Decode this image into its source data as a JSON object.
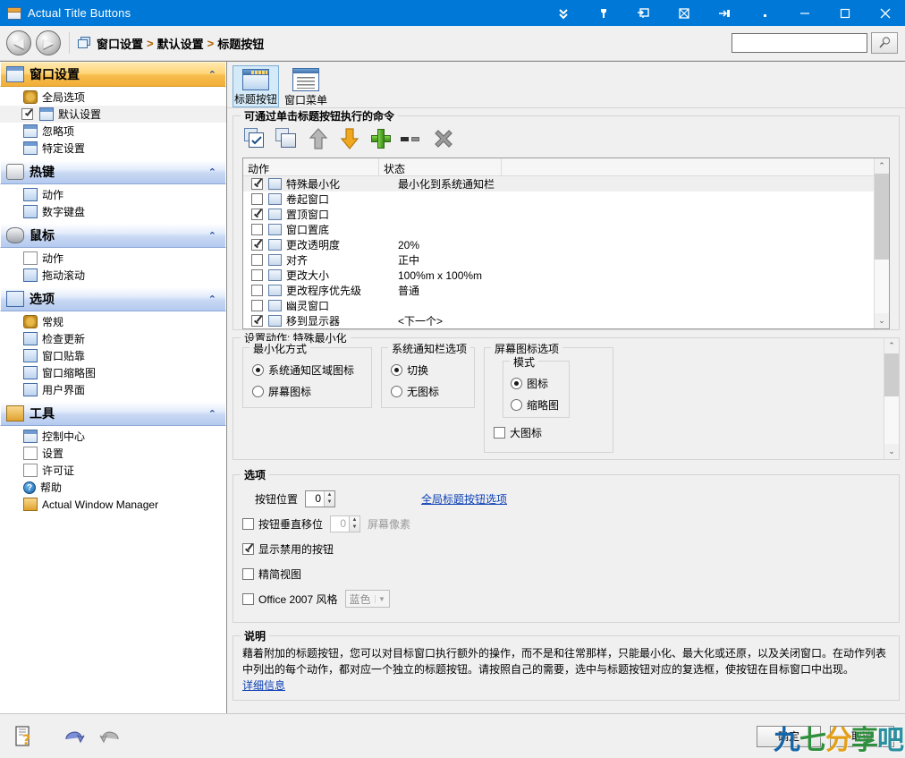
{
  "window": {
    "title": "Actual Title Buttons",
    "icon": "window-app-icon",
    "titlebar_buttons": [
      {
        "name": "collapse-all-icon",
        "glyph": "⯆"
      },
      {
        "name": "pin-tool-icon",
        "glyph": "⚲"
      },
      {
        "name": "export-icon",
        "glyph": "⊞"
      },
      {
        "name": "transparency-icon",
        "glyph": "▨"
      },
      {
        "name": "roll-up-icon",
        "glyph": "⇥"
      },
      {
        "name": "dot-icon",
        "glyph": "·"
      },
      {
        "name": "minimize-icon",
        "glyph": "—"
      },
      {
        "name": "maximize-icon",
        "glyph": "▢"
      },
      {
        "name": "close-icon",
        "glyph": "✕"
      }
    ]
  },
  "nav": {
    "back_glyph": "◀",
    "forward_glyph": "▶",
    "breadcrumb": [
      "窗口设置",
      "默认设置",
      "标题按钮"
    ],
    "separator": ">",
    "search_value": "",
    "search_placeholder": "",
    "search_button_icon": "search-icon"
  },
  "sidebar": {
    "groups": [
      {
        "title": "窗口设置",
        "style": "orange",
        "icon": "window-settings-icon",
        "collapse_glyph": "⌃",
        "items": [
          {
            "label": "全局选项",
            "icon": "global-options-icon",
            "checkbox": false,
            "selected": false
          },
          {
            "label": "默认设置",
            "icon": "default-settings-icon",
            "checkbox": true,
            "checked": true,
            "selected": true
          },
          {
            "label": "忽略项",
            "icon": "ignore-icon",
            "checkbox": false,
            "selected": false
          },
          {
            "label": "特定设置",
            "icon": "specific-settings-icon",
            "checkbox": false,
            "selected": false
          }
        ]
      },
      {
        "title": "热键",
        "style": "blue",
        "icon": "keyboard-icon",
        "collapse_glyph": "⌃",
        "items": [
          {
            "label": "动作",
            "icon": "action-icon",
            "checkbox": false,
            "selected": false
          },
          {
            "label": "数字键盘",
            "icon": "numpad-icon",
            "checkbox": false,
            "selected": false
          }
        ]
      },
      {
        "title": "鼠标",
        "style": "blue",
        "icon": "mouse-icon",
        "collapse_glyph": "⌃",
        "items": [
          {
            "label": "动作",
            "icon": "action-icon",
            "checkbox": false,
            "selected": false
          },
          {
            "label": "拖动滚动",
            "icon": "drag-scroll-icon",
            "checkbox": false,
            "selected": false
          }
        ]
      },
      {
        "title": "选项",
        "style": "blue",
        "icon": "options-icon",
        "collapse_glyph": "⌃",
        "items": [
          {
            "label": "常规",
            "icon": "general-icon",
            "checkbox": false,
            "selected": false
          },
          {
            "label": "检查更新",
            "icon": "check-updates-icon",
            "checkbox": false,
            "selected": false
          },
          {
            "label": "窗口贴靠",
            "icon": "window-snap-icon",
            "checkbox": false,
            "selected": false
          },
          {
            "label": "窗口缩略图",
            "icon": "window-thumbnail-icon",
            "checkbox": false,
            "selected": false
          },
          {
            "label": "用户界面",
            "icon": "user-interface-icon",
            "checkbox": false,
            "selected": false
          }
        ]
      },
      {
        "title": "工具",
        "style": "blue",
        "icon": "tools-icon",
        "collapse_glyph": "⌃",
        "items": [
          {
            "label": "控制中心",
            "icon": "control-center-icon",
            "checkbox": false,
            "selected": false
          },
          {
            "label": "设置",
            "icon": "settings-icon",
            "checkbox": false,
            "selected": false
          },
          {
            "label": "许可证",
            "icon": "license-key-icon",
            "checkbox": false,
            "selected": false
          },
          {
            "label": "帮助",
            "icon": "help-icon",
            "checkbox": false,
            "selected": false
          },
          {
            "label": "Actual Window Manager",
            "icon": "actual-window-manager-icon",
            "checkbox": false,
            "selected": false
          }
        ]
      }
    ]
  },
  "tabs": [
    {
      "label": "标题按钮",
      "icon": "title-buttons-icon",
      "active": true
    },
    {
      "label": "窗口菜单",
      "icon": "window-menu-icon",
      "active": false
    }
  ],
  "command_group": {
    "legend": "可通过单击标题按钮执行的命令",
    "toolbar": [
      {
        "name": "check-all-button",
        "icon": "check-copy-icon"
      },
      {
        "name": "copy-button",
        "icon": "copy-icon"
      },
      {
        "name": "move-up-button",
        "icon": "up-arrow-icon"
      },
      {
        "name": "move-down-button",
        "icon": "down-arrow-icon"
      },
      {
        "name": "add-button",
        "icon": "plus-icon"
      },
      {
        "name": "remove-button",
        "icon": "minus-icon"
      },
      {
        "name": "delete-button",
        "icon": "x-close-icon"
      }
    ]
  },
  "action_list": {
    "columns": [
      "动作",
      "状态"
    ],
    "rows": [
      {
        "checked": true,
        "action": "特殊最小化",
        "state": "最小化到系统通知栏",
        "selected": true
      },
      {
        "checked": false,
        "action": "卷起窗口",
        "state": "",
        "selected": false
      },
      {
        "checked": true,
        "action": "置顶窗口",
        "state": "",
        "selected": false
      },
      {
        "checked": false,
        "action": "窗口置底",
        "state": "",
        "selected": false
      },
      {
        "checked": true,
        "action": "更改透明度",
        "state": "20%",
        "selected": false
      },
      {
        "checked": false,
        "action": "对齐",
        "state": "正中",
        "selected": false
      },
      {
        "checked": false,
        "action": "更改大小",
        "state": "100%m x 100%m",
        "selected": false
      },
      {
        "checked": false,
        "action": "更改程序优先级",
        "state": "普通",
        "selected": false
      },
      {
        "checked": false,
        "action": "幽灵窗口",
        "state": "",
        "selected": false
      },
      {
        "checked": true,
        "action": "移到显示器",
        "state": "<下一个>",
        "selected": false
      }
    ]
  },
  "settings_group": {
    "legend": "设置动作: 特殊最小化",
    "subgroups": [
      {
        "legend": "最小化方式",
        "options": [
          {
            "label": "系统通知区域图标",
            "selected": true
          },
          {
            "label": "屏幕图标",
            "selected": false
          }
        ]
      },
      {
        "legend": "系统通知栏选项",
        "options": [
          {
            "label": "切换",
            "selected": true
          },
          {
            "label": "无图标",
            "selected": false
          }
        ]
      },
      {
        "legend": "屏幕图标选项",
        "inner": {
          "legend": "模式",
          "options": [
            {
              "label": "图标",
              "selected": true
            },
            {
              "label": "缩略图",
              "selected": false
            }
          ]
        },
        "checkbox": {
          "label": "大图标",
          "checked": false
        }
      }
    ]
  },
  "options_group": {
    "legend": "选项",
    "button_position_label": "按钮位置",
    "button_position_value": "0",
    "global_link": "全局标题按钮选项",
    "vertical_shift_label": "按钮垂直移位",
    "vertical_shift_checked": false,
    "vertical_shift_value": "0",
    "vertical_shift_units": "屏幕像素",
    "show_disabled_label": "显示禁用的按钮",
    "show_disabled_checked": true,
    "compact_view_label": "精简视图",
    "compact_view_checked": false,
    "office_style_label": "Office 2007 风格",
    "office_style_checked": false,
    "office_style_value": "蓝色"
  },
  "description_group": {
    "legend": "说明",
    "text": "藉着附加的标题按钮，您可以对目标窗口执行额外的操作，而不是和往常那样，只能最小化、最大化或还原，以及关闭窗口。在动作列表中列出的每个动作，都对应一个独立的标题按钮。请按照自己的需要，选中与标题按钮对应的复选框，使按钮在目标窗口中出现。",
    "link": "详细信息"
  },
  "footer": {
    "help_icon": "help-document-icon",
    "undo_icon": "undo-icon",
    "redo_icon": "redo-icon",
    "ok_label": "确定",
    "cancel_label": "取消"
  },
  "watermark": {
    "chars": [
      {
        "t": "九",
        "color": "#1565a8"
      },
      {
        "t": "七",
        "color": "#2f8f3e"
      },
      {
        "t": "分",
        "color": "#e2a01a"
      },
      {
        "t": "享",
        "color": "#2f8f3e"
      },
      {
        "t": "吧",
        "color": "#2a8fa0"
      }
    ]
  },
  "colors": {
    "titlebar": "#0078d7",
    "accent_orange": "#f2ae38",
    "link": "#0b3fb5"
  }
}
